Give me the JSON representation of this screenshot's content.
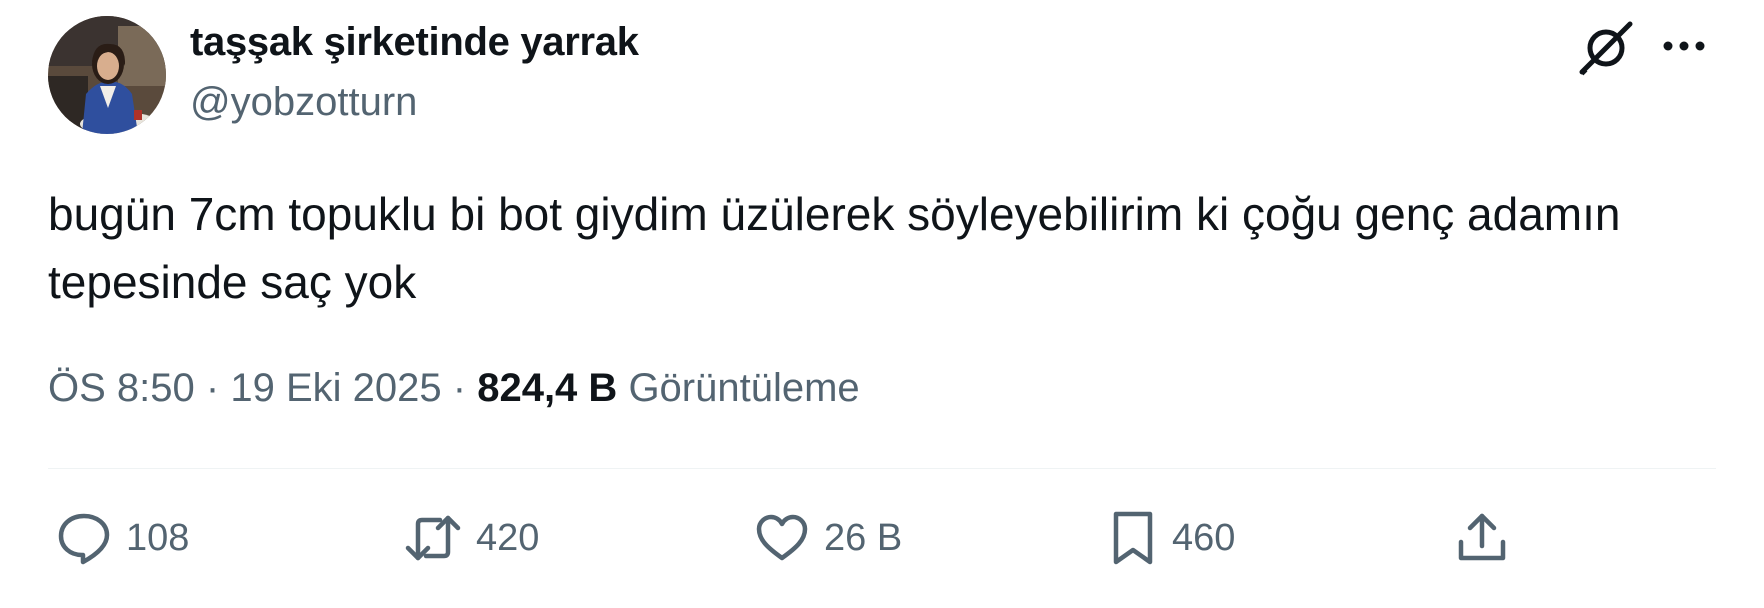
{
  "author": {
    "display_name": "taşşak şirketinde yarrak",
    "handle": "@yobzotturn"
  },
  "tweet": {
    "text": "bugün 7cm topuklu bi bot giydim üzülerek söyleyebilirim ki çoğu genç adamın tepesinde saç yok"
  },
  "meta": {
    "time": "ÖS 8:50",
    "separator": "·",
    "date": "19 Eki 2025",
    "views_count": "824,4 B",
    "views_label": "Görüntüleme"
  },
  "actions": {
    "replies": "108",
    "reposts": "420",
    "likes": "26 B",
    "bookmarks": "460"
  },
  "icons": {
    "grok": "grok-icon",
    "more": "more-icon",
    "reply": "reply-icon",
    "repost": "repost-icon",
    "like": "heart-icon",
    "bookmark": "bookmark-icon",
    "share": "share-icon"
  },
  "colors": {
    "text_primary": "#0f1419",
    "text_secondary": "#536471",
    "divider": "#eff3f4",
    "background": "#ffffff"
  }
}
